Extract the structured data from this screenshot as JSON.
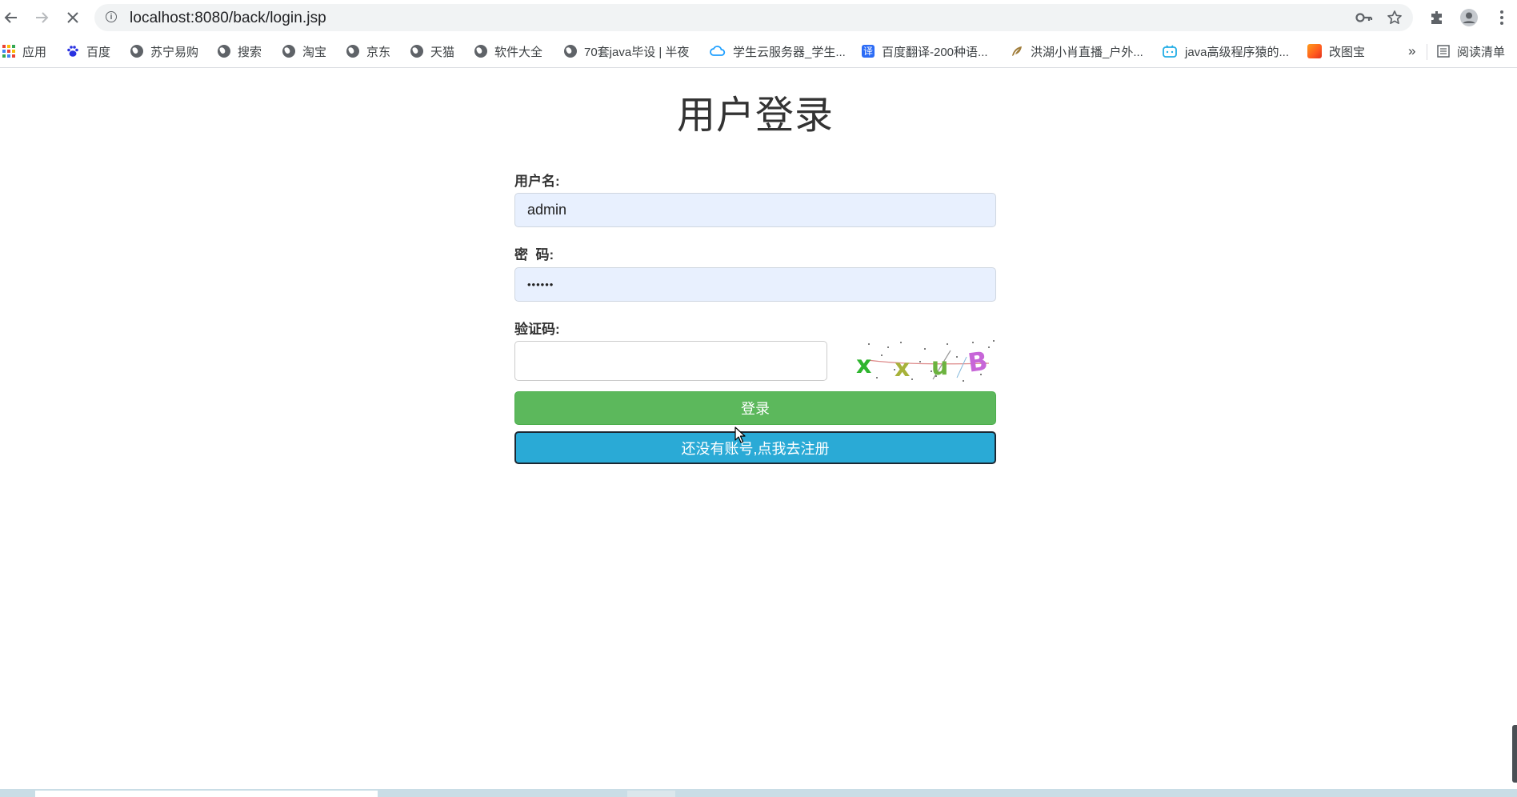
{
  "browser": {
    "url": "localhost:8080/back/login.jsp",
    "nav": {
      "back": "back-icon",
      "forward": "forward-icon",
      "stop": "stop-loading-icon"
    },
    "icons": [
      "key-icon",
      "star-icon",
      "extensions-icon",
      "profile-icon",
      "menu-icon"
    ]
  },
  "bookmarks": {
    "items": [
      {
        "label": "应用",
        "icon": "apps-grid-icon"
      },
      {
        "label": "百度",
        "icon": "baidu-paw-icon"
      },
      {
        "label": "苏宁易购",
        "icon": "globe-icon"
      },
      {
        "label": "搜索",
        "icon": "globe-icon"
      },
      {
        "label": "淘宝",
        "icon": "globe-icon"
      },
      {
        "label": "京东",
        "icon": "globe-icon"
      },
      {
        "label": "天猫",
        "icon": "globe-icon"
      },
      {
        "label": "软件大全",
        "icon": "globe-icon"
      },
      {
        "label": "70套java毕设 | 半夜",
        "icon": "globe-icon"
      },
      {
        "label": "学生云服务器_学生...",
        "icon": "cloud-icon"
      },
      {
        "label": "百度翻译-200种语...",
        "icon": "translate-icon"
      },
      {
        "label": "洪湖小肖直播_户外...",
        "icon": "feather-icon"
      },
      {
        "label": "java高级程序猿的...",
        "icon": "bilibili-icon"
      },
      {
        "label": "改图宝",
        "icon": "orange-square-icon"
      }
    ],
    "overflow": "»",
    "reading_list": "阅读清单"
  },
  "page": {
    "title": "用户登录",
    "username_label": "用户名:",
    "username_value": "admin",
    "password_label": "密  码:",
    "password_value": "••••••",
    "captcha_label": "验证码:",
    "captcha_value": "",
    "captcha_text": "x x u B",
    "login_button": "登录",
    "register_button": "还没有账号,点我去注册"
  },
  "colors": {
    "login_button": "#5cb85c",
    "register_button": "#2aaad6",
    "autofill_bg": "#e8f0fe"
  }
}
